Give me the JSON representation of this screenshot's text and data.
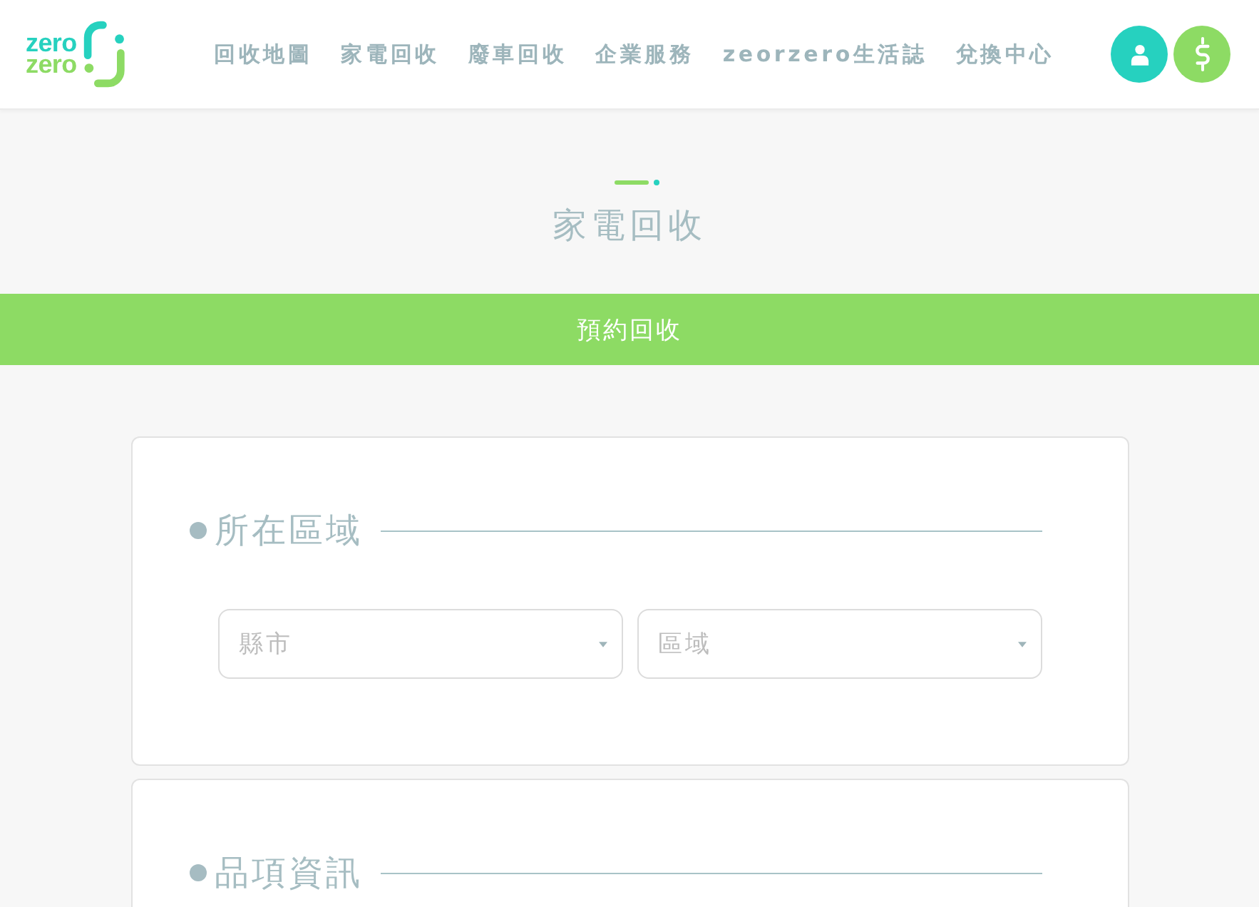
{
  "header": {
    "logo": {
      "line_1": "zero",
      "line_2": "zero"
    },
    "nav": [
      "回收地圖",
      "家電回收",
      "廢車回收",
      "企業服務",
      "zeorzero生活誌",
      "兌換中心"
    ]
  },
  "page_title": "家電回收",
  "banner": "預約回收",
  "sections": [
    {
      "title": "所在區域",
      "selects": [
        {
          "placeholder": "縣市"
        },
        {
          "placeholder": "區域"
        }
      ]
    },
    {
      "title": "品項資訊"
    }
  ]
}
